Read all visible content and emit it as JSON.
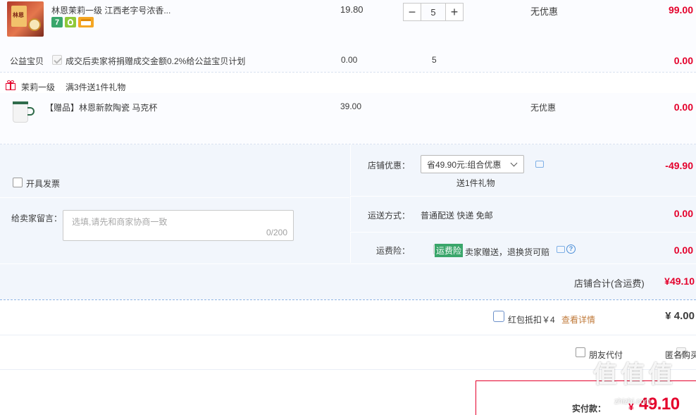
{
  "item": {
    "title": "林恩茉莉一级 江西老字号浓香...",
    "unit_price": "19.80",
    "quantity": "5",
    "discount_text": "无优惠",
    "subtotal": "99.00",
    "badge_seven": "7",
    "thumb_label": "林恩"
  },
  "charity": {
    "label": "公益宝贝",
    "text": "成交后卖家将捐赠成交金额0.2%给公益宝贝计划",
    "price": "0.00",
    "quantity": "5",
    "subtotal": "0.00"
  },
  "gift_promo": {
    "shop": "茉莉一级",
    "text": "满3件送1件礼物"
  },
  "gift_item": {
    "title": "【赠品】林恩新款陶瓷 马克杯",
    "price": "39.00",
    "discount_text": "无优惠",
    "subtotal": "0.00"
  },
  "invoice": {
    "label": "开具发票"
  },
  "message": {
    "label": "给卖家留言：",
    "placeholder": "选填,请先和商家协商一致",
    "counter": "0/200"
  },
  "shop_discount": {
    "label": "店铺优惠：",
    "select_value": "省49.90元:组合优惠",
    "sub_text": "送1件礼物",
    "amount": "-49.90"
  },
  "shipping": {
    "label": "运送方式：",
    "text": "普通配送 快递 免邮",
    "amount": "0.00"
  },
  "insurance": {
    "label": "运费险：",
    "tag": "运费险",
    "text": "卖家赠送，退换货可赔",
    "amount": "0.00"
  },
  "shop_total": {
    "label": "店铺合计(含运费)",
    "amount": "¥49.10"
  },
  "red_packet": {
    "label": "红包抵扣￥4",
    "link": "查看详情",
    "amount": "¥ 4.00"
  },
  "options": {
    "friend_pay": "朋友代付",
    "anonymous": "匿名购买"
  },
  "pay": {
    "label": "实付款：",
    "currency": "¥",
    "amount": "49.10"
  },
  "watermark": {
    "text": "值 值 值",
    "sub": "zhizhi.com"
  },
  "colors": {
    "accent_red": "#e4002b",
    "link_orange": "#ff6600",
    "row_bg": "#f3f7fd",
    "tag_green": "#3aa66b"
  }
}
